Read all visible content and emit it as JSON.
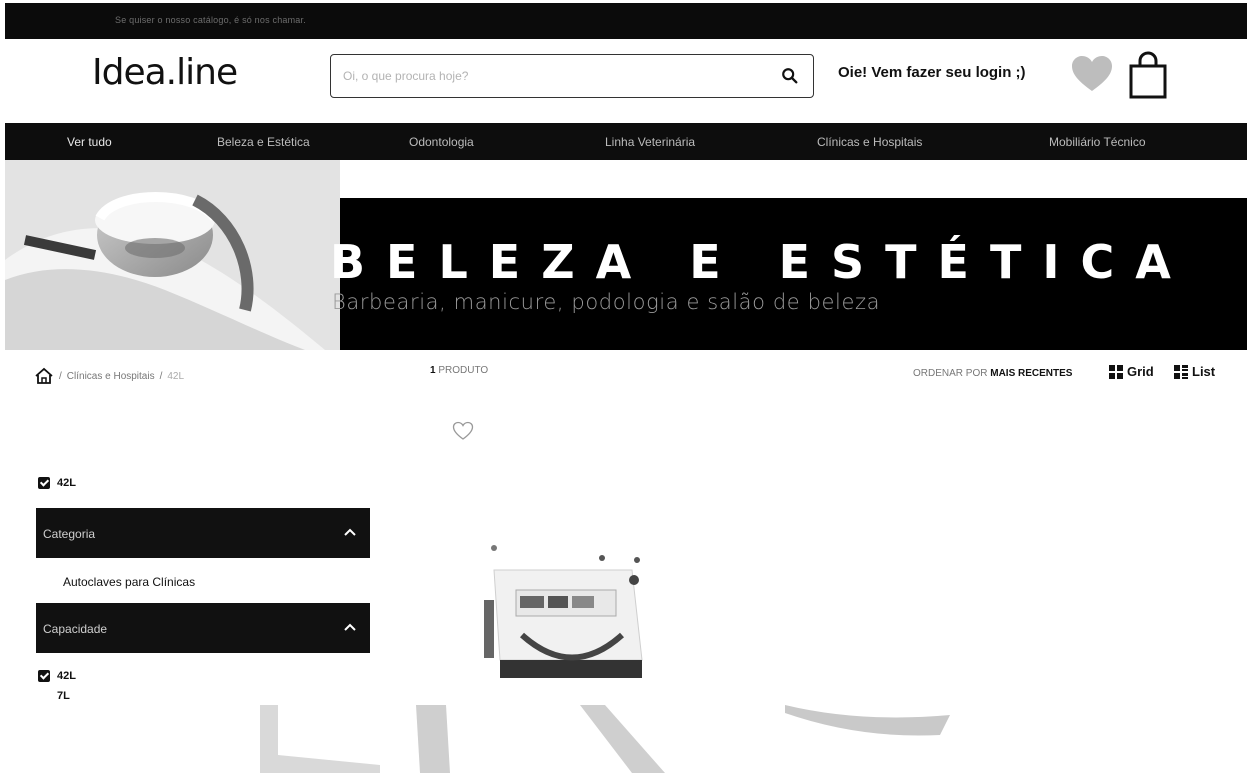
{
  "topbar": {
    "message": "Se quiser o nosso catálogo, é só nos chamar."
  },
  "header": {
    "logo": "Idea.line",
    "search_placeholder": "Oi, o que procura hoje?",
    "login_text": "Oie! Vem fazer seu login ;)"
  },
  "nav": {
    "items": [
      "Ver tudo",
      "Beleza e Estética",
      "Odontologia",
      "Linha Veterinária",
      "Clínicas e Hospitais",
      "Mobiliário Técnico"
    ]
  },
  "banner": {
    "title": "BELEZA E ESTÉTICA",
    "subtitle": "Barbearia, manicure, podologia e salão de beleza"
  },
  "breadcrumb": {
    "sep": "/",
    "items": [
      "Clínicas e Hospitais",
      "42L"
    ]
  },
  "results": {
    "count": "1",
    "label": "PRODUTO"
  },
  "sort": {
    "prefix": "ORDENAR POR",
    "value": "MAIS RECENTES"
  },
  "view": {
    "grid": "Grid",
    "list": "List"
  },
  "filters": {
    "active_chip": "42L",
    "categoria": {
      "title": "Categoria",
      "options": [
        "Autoclaves para Clínicas"
      ]
    },
    "capacidade": {
      "title": "Capacidade",
      "options": [
        {
          "label": "42L",
          "checked": true
        },
        {
          "label": "7L",
          "checked": false
        }
      ]
    }
  },
  "colors": {
    "header_bg": "#0d0d0d",
    "accent": "#111111",
    "heart": "#bdbdbd"
  },
  "icons": [
    "search-icon",
    "heart-icon",
    "bag-icon",
    "home-icon",
    "grid-icon",
    "list-icon",
    "chevron-up-icon",
    "checkbox-icon"
  ]
}
